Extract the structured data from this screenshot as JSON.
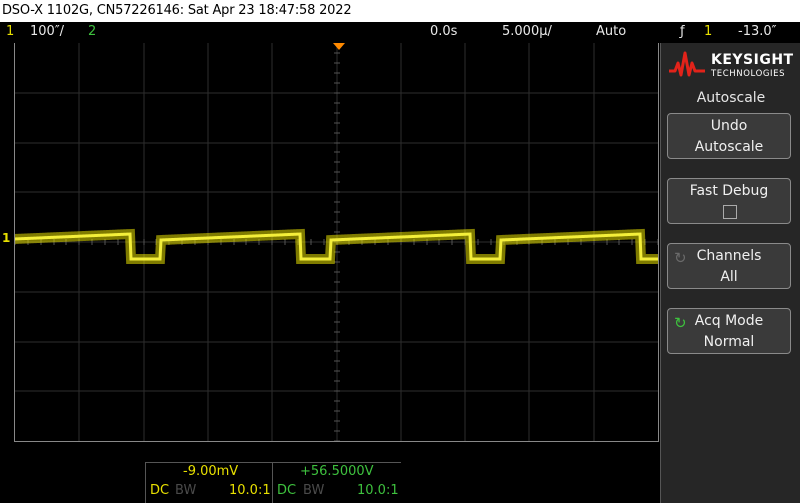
{
  "title_bar": "DSO-X 1102G, CN57226146: Sat Apr 23 18:47:58 2022",
  "status": {
    "ch1_num": "1",
    "ch1_scale": "100″/",
    "ch2_num": "2",
    "time_delay": "0.0s",
    "time_scale": "5.000µ/",
    "trigger_mode": "Auto",
    "trigger_icon": "ƒ",
    "trigger_source": "1",
    "trigger_level": "-13.0″"
  },
  "sidebar": {
    "brand": "KEYSIGHT",
    "brand_sub": "TECHNOLOGIES",
    "menu_title": "Autoscale",
    "keys": [
      {
        "l1": "Undo",
        "l2": "Autoscale"
      },
      {
        "l1": "Fast Debug",
        "l2": ""
      },
      {
        "l1": "Channels",
        "l2": "All"
      },
      {
        "l1": "Acq Mode",
        "l2": "Normal"
      }
    ]
  },
  "bottom": {
    "ch1_offset": "-9.00mV",
    "ch2_offset": "+56.5000V",
    "ch1_coupling": "DC",
    "ch1_bw": "BW",
    "ch1_probe": "10.0:1",
    "ch2_coupling": "DC",
    "ch2_bw": "BW",
    "ch2_probe": "10.0:1"
  },
  "colors": {
    "ch1": "#e8e000",
    "ch2": "#3ec13e",
    "trigger": "#ff8a00",
    "logo_red": "#e2231a"
  }
}
